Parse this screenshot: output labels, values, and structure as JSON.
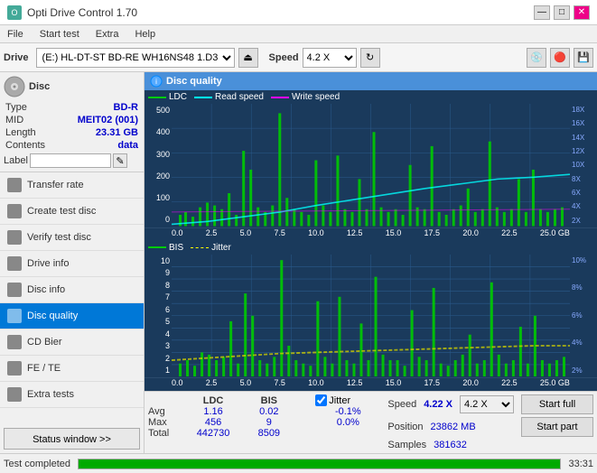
{
  "app": {
    "title": "Opti Drive Control 1.70",
    "icon": "ODC"
  },
  "titlebar": {
    "title": "Opti Drive Control 1.70",
    "minimize": "—",
    "maximize": "□",
    "close": "✕"
  },
  "menu": {
    "items": [
      "File",
      "Start test",
      "Extra",
      "Help"
    ]
  },
  "drivebar": {
    "label": "Drive",
    "drive_value": "(E:)  HL-DT-ST BD-RE  WH16NS48 1.D3",
    "speed_label": "Speed",
    "speed_value": "4.2 X"
  },
  "disc": {
    "title": "Disc",
    "type_label": "Type",
    "type_val": "BD-R",
    "mid_label": "MID",
    "mid_val": "MEIT02 (001)",
    "length_label": "Length",
    "length_val": "23.31 GB",
    "contents_label": "Contents",
    "contents_val": "data",
    "label_label": "Label"
  },
  "nav": {
    "items": [
      {
        "id": "transfer-rate",
        "label": "Transfer rate",
        "active": false
      },
      {
        "id": "create-test-disc",
        "label": "Create test disc",
        "active": false
      },
      {
        "id": "verify-test-disc",
        "label": "Verify test disc",
        "active": false
      },
      {
        "id": "drive-info",
        "label": "Drive info",
        "active": false
      },
      {
        "id": "disc-info",
        "label": "Disc info",
        "active": false
      },
      {
        "id": "disc-quality",
        "label": "Disc quality",
        "active": true
      },
      {
        "id": "cd-bier",
        "label": "CD Bier",
        "active": false
      },
      {
        "id": "fe-te",
        "label": "FE / TE",
        "active": false
      },
      {
        "id": "extra-tests",
        "label": "Extra tests",
        "active": false
      }
    ],
    "status_button": "Status window >>"
  },
  "quality": {
    "panel_title": "Disc quality",
    "legend": {
      "ldc": "LDC",
      "read_speed": "Read speed",
      "write_speed": "Write speed"
    },
    "legend2": {
      "bis": "BIS",
      "jitter": "Jitter"
    },
    "x_labels": [
      "0.0",
      "2.5",
      "5.0",
      "7.5",
      "10.0",
      "12.5",
      "15.0",
      "17.5",
      "20.0",
      "22.5",
      "25.0 GB"
    ],
    "y_labels_top": [
      "500",
      "400",
      "300",
      "200",
      "100",
      "0"
    ],
    "y_labels_top_right": [
      "18X",
      "16X",
      "14X",
      "12X",
      "10X",
      "8X",
      "6X",
      "4X",
      "2X"
    ],
    "y_labels_bot": [
      "10",
      "9",
      "8",
      "7",
      "6",
      "5",
      "4",
      "3",
      "2",
      "1"
    ],
    "y_labels_bot_right": [
      "10%",
      "8%",
      "6%",
      "4%",
      "2%"
    ]
  },
  "stats": {
    "headers": [
      "LDC",
      "BIS",
      "",
      "Jitter",
      "Speed",
      ""
    ],
    "avg_label": "Avg",
    "avg_ldc": "1.16",
    "avg_bis": "0.02",
    "avg_jitter": "-0.1%",
    "max_label": "Max",
    "max_ldc": "456",
    "max_bis": "9",
    "max_jitter": "0.0%",
    "total_label": "Total",
    "total_ldc": "442730",
    "total_bis": "8509",
    "speed_label": "Speed",
    "speed_val": "4.22 X",
    "speed_select": "4.2 X",
    "position_label": "Position",
    "position_val": "23862 MB",
    "samples_label": "Samples",
    "samples_val": "381632",
    "jitter_checked": true,
    "jitter_label": "Jitter",
    "start_full": "Start full",
    "start_part": "Start part"
  },
  "statusbar": {
    "text": "Test completed",
    "progress": 100,
    "time": "33:31"
  },
  "colors": {
    "bg_chart": "#1a3a5c",
    "ldc_color": "#00cc00",
    "read_speed": "#00ffff",
    "write_speed": "#ff00ff",
    "bis_color": "#00cc00",
    "jitter_color": "#ffff00",
    "grid_line": "#2a5a8c"
  }
}
